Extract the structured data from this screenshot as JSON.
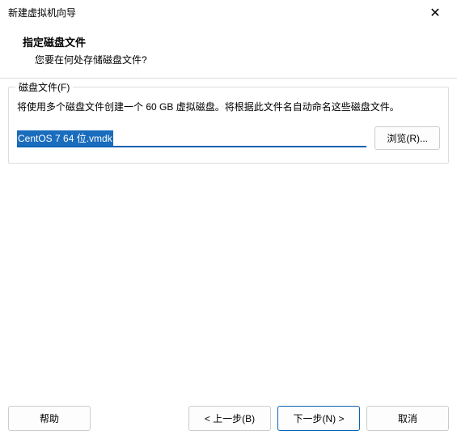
{
  "window": {
    "title": "新建虚拟机向导"
  },
  "header": {
    "title": "指定磁盘文件",
    "subtitle": "您要在何处存储磁盘文件?"
  },
  "group": {
    "label": "磁盘文件(F)",
    "description": "将使用多个磁盘文件创建一个 60 GB 虚拟磁盘。将根据此文件名自动命名这些磁盘文件。",
    "input_value": "CentOS 7 64 位.vmdk",
    "browse_label": "浏览(R)..."
  },
  "footer": {
    "help": "帮助",
    "back": "< 上一步(B)",
    "next": "下一步(N) >",
    "cancel": "取消"
  }
}
